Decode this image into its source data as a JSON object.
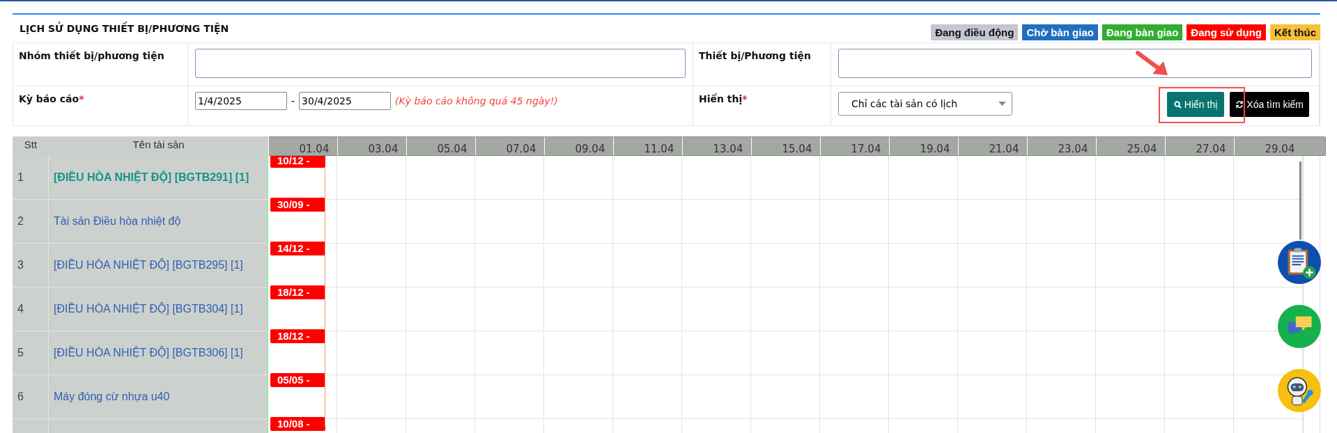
{
  "title": "LỊCH SỬ DỤNG THIẾT BỊ/PHƯƠNG TIỆN",
  "legend": [
    {
      "label": "Đang điều động",
      "color": "#c3c7d0"
    },
    {
      "label": "Chờ bàn giao",
      "color": "#1f6fbf"
    },
    {
      "label": "Đang bàn giao",
      "color": "#2fae2f"
    },
    {
      "label": "Đang sử dụng",
      "color": "#ff0000"
    },
    {
      "label": "Kết thúc",
      "color": "#f6c03a"
    }
  ],
  "filters": {
    "group_label": "Nhóm thiết bị/phương tiện",
    "device_label": "Thiết bị/Phương tiện",
    "period_label": "Kỳ báo cáo",
    "period_from": "1/4/2025",
    "period_separator": "-",
    "period_to": "30/4/2025",
    "period_note": "(Kỳ báo cáo không quá 45 ngày!)",
    "display_label": "Hiển thị",
    "display_value": "Chỉ các tài sản có lịch",
    "required_mark": "*",
    "show_button": "Hiển thị",
    "clear_button": "Xóa tìm kiếm"
  },
  "table": {
    "columns": [
      "Stt",
      "Tên tài sản"
    ],
    "dates": [
      "01.04",
      "03.04",
      "05.04",
      "07.04",
      "09.04",
      "11.04",
      "13.04",
      "15.04",
      "17.04",
      "19.04",
      "21.04",
      "23.04",
      "25.04",
      "27.04",
      "29.04"
    ],
    "rows": [
      {
        "stt": "1",
        "name": "[ĐIỀU HÒA NHIỆT ĐỘ] [BGTB291] [1]",
        "selected": true,
        "bar": "10/12 -"
      },
      {
        "stt": "2",
        "name": "Tài sản Điều hòa nhiệt độ",
        "selected": false,
        "bar": "30/09 -"
      },
      {
        "stt": "3",
        "name": "[ĐIỀU HÒA NHIỆT ĐỘ] [BGTB295] [1]",
        "selected": false,
        "bar": "14/12 -"
      },
      {
        "stt": "4",
        "name": "[ĐIỀU HÒA NHIỆT ĐỘ] [BGTB304] [1]",
        "selected": false,
        "bar": "18/12 -"
      },
      {
        "stt": "5",
        "name": "[ĐIỀU HÒA NHIỆT ĐỘ] [BGTB306] [1]",
        "selected": false,
        "bar": "18/12 -"
      },
      {
        "stt": "6",
        "name": "Máy đóng cừ nhựa u40",
        "selected": false,
        "bar": "05/05 -"
      },
      {
        "bar": "10/08 -"
      }
    ]
  }
}
